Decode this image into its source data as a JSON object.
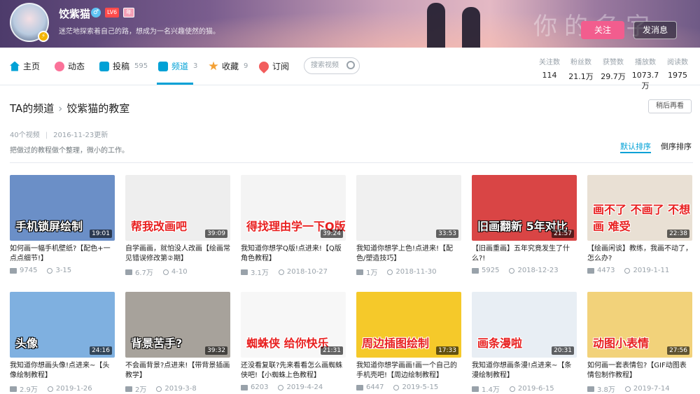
{
  "header": {
    "username": "饺紫猫",
    "sex_icon": "♂",
    "level": "LV6",
    "vip": "年",
    "signature": "迷茫地探索着自己的路，想成为一名兴趣使然的猫。",
    "banner_title": "你的名字",
    "follow_label": "关注",
    "message_label": "发消息"
  },
  "nav": {
    "items": [
      {
        "label": "主页",
        "count": "",
        "icon": "home-icon",
        "color": "#00a1d6"
      },
      {
        "label": "动态",
        "count": "",
        "icon": "dynamic-icon",
        "color": "#fb7299"
      },
      {
        "label": "投稿",
        "count": "595",
        "icon": "upload-icon",
        "color": "#00a1d6"
      },
      {
        "label": "频道",
        "count": "3",
        "icon": "channel-icon",
        "color": "#00a1d6"
      },
      {
        "label": "收藏",
        "count": "9",
        "icon": "favorite-icon",
        "color": "#f3a034"
      },
      {
        "label": "订阅",
        "count": "",
        "icon": "subscribe-icon",
        "color": "#f25d5d"
      }
    ],
    "search_placeholder": "搜索视频",
    "stats": [
      {
        "label": "关注数",
        "value": "114"
      },
      {
        "label": "粉丝数",
        "value": "21.1万"
      },
      {
        "label": "获赞数",
        "value": "29.7万"
      },
      {
        "label": "播放数",
        "value": "1073.7万"
      },
      {
        "label": "阅读数",
        "value": "1975"
      }
    ]
  },
  "channel": {
    "breadcrumb_root": "TA的频道",
    "breadcrumb_current": "饺紫猫的教室",
    "later_label": "稍后再看",
    "video_count": "40个视频",
    "updated": "2016-11-23更新",
    "description": "把做过的教程做个整理，微小的工作。",
    "sort_default": "默认排序",
    "sort_reverse": "倒序排序"
  },
  "videos": [
    {
      "caption": "手机锁屏绘制",
      "duration": "19:01",
      "title": "如何画一幅手机壁纸?【配色+一点点细节!】",
      "plays": "9745",
      "date": "3-15",
      "bg": "#6b8fc7"
    },
    {
      "caption": "帮我改画吧",
      "duration": "39:09",
      "title": "自学画画，就怕没人改画【绘画常见错误修改第②期】",
      "plays": "6.7万",
      "date": "4-10",
      "bg": "#eeeeee"
    },
    {
      "caption": "得找理由学一下Q版",
      "duration": "39:24",
      "title": "我知道你想学Q版!点进来!【Q版角色教程】",
      "plays": "3.1万",
      "date": "2018-10-27",
      "bg": "#f4f4f4"
    },
    {
      "caption": "",
      "duration": "33:53",
      "title": "我知道你想学上色!点进来!【配色/塑造技巧】",
      "plays": "1万",
      "date": "2018-11-30",
      "bg": "#f0f0f0"
    },
    {
      "caption": "旧画翻新 5年对比",
      "duration": "21:57",
      "title": "【旧画重画】五年究竟发生了什么?!",
      "plays": "5925",
      "date": "2018-12-23",
      "bg": "#d94545"
    },
    {
      "caption": "画不了 不画了 不想画 难受",
      "duration": "22:38",
      "title": "【绘画闲谈】教练，我画不动了，怎么办?",
      "plays": "4473",
      "date": "2019-1-11",
      "bg": "#e9e0d4"
    },
    {
      "caption": "头像",
      "duration": "24:16",
      "title": "我知道你想画头像!点进来~【头像绘制教程】",
      "plays": "2.9万",
      "date": "2019-1-26",
      "bg": "#7fb0e0"
    },
    {
      "caption": "背景苦手?",
      "duration": "39:32",
      "title": "不会画背景?点进来!【带背景插画教学】",
      "plays": "2万",
      "date": "2019-3-8",
      "bg": "#a7a29b"
    },
    {
      "caption": "蜘蛛侠 给你快乐",
      "duration": "21:31",
      "title": "还没看复联?先来看看怎么画蜘蛛侠吧!【小蜘蛛上色教程】",
      "plays": "6203",
      "date": "2019-4-24",
      "bg": "#f7f7f7"
    },
    {
      "caption": "周边插图绘制",
      "duration": "17:33",
      "title": "我知道你想学画画!画一个自己的手机壳吧!【周边绘制教程】",
      "plays": "6447",
      "date": "2019-5-15",
      "bg": "#f5c92a"
    },
    {
      "caption": "画条漫啦",
      "duration": "20:31",
      "title": "我知道你想画条漫!点进来~【条漫绘制教程】",
      "plays": "1.4万",
      "date": "2019-6-15",
      "bg": "#e8eef4"
    },
    {
      "caption": "动图小表情",
      "duration": "27:56",
      "title": "如何画一套表情包?【GIF动图表情包制作教程】",
      "plays": "3.8万",
      "date": "2019-7-14",
      "bg": "#f2d27a"
    }
  ]
}
